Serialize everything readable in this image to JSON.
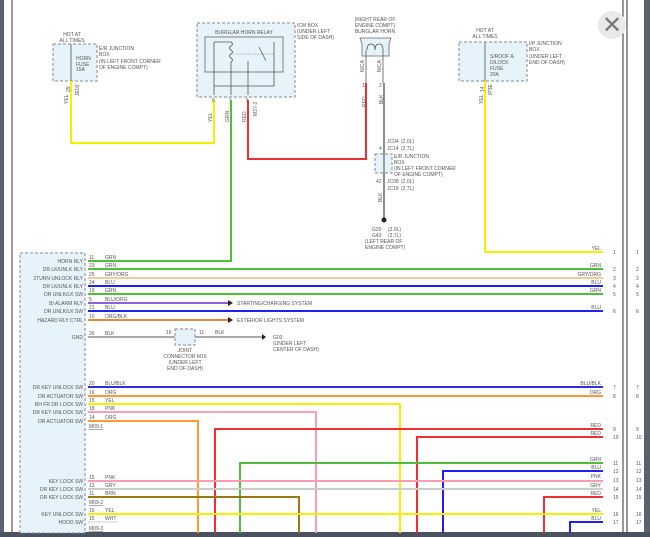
{
  "close_button": {
    "icon": "close-icon",
    "glyph": "✕"
  },
  "horn_fuse": {
    "hot": [
      "HOT AT",
      "ALL TIMES"
    ],
    "fuse": [
      "HORN",
      "FUSE",
      "15A"
    ],
    "location": [
      "E/R JUNCTION",
      "BOX",
      "(IN LEFT FRONT CORNER",
      "OF ENGINE COMPT)"
    ],
    "pin": "29",
    "connector": "JE03",
    "wire": "YEL"
  },
  "icm_box": {
    "title": "BURGLAR HORN RELAY",
    "location": [
      "ICM BOX",
      "(UNDER LEFT",
      "SIDE OF DASH)"
    ],
    "pins": [
      "6",
      "1",
      "5",
      "M37-2"
    ],
    "wires": [
      "YEL",
      "GRN",
      "RED"
    ]
  },
  "horn": {
    "location": [
      "(RIGHT REAR OF",
      "ENGINE COMPT)",
      "BURGLAR HORN"
    ],
    "pins": [
      "1",
      "2"
    ],
    "nca": "N/CA",
    "wires": [
      "RED",
      "BLK"
    ]
  },
  "er_junction": {
    "top": [
      "JC04",
      "(2.0L)",
      "JC14",
      "(2.7L)"
    ],
    "pin_top": "4",
    "location": [
      "E/R JUNCTION",
      "BOX",
      "(IN LEFT FRONT CORNER",
      "OF ENGINE COMPT)"
    ],
    "bottom": [
      "JC08",
      "(2.0L)",
      "JC18",
      "(2.7L)"
    ],
    "pin_bottom": "42",
    "wire": "BLK",
    "ground": [
      "G20",
      "(2.0L)",
      "G43",
      "(2.7L)",
      "(LEFT REAR OF",
      "ENGINE COMPT)"
    ]
  },
  "ip_junction": {
    "hot": [
      "HOT AT",
      "ALL TIMES"
    ],
    "fuse": [
      "S/ROOF &",
      "D/LOCK",
      "FUSE",
      "20A"
    ],
    "location": [
      "I/P JUNCTION",
      "BOX",
      "(UNDER LEFT",
      "END OF DASH)"
    ],
    "pin": "14",
    "connector": "IP3E",
    "wire": "YEL"
  },
  "module_rows": [
    {
      "label": "HORN RLY",
      "pin": "11",
      "wire": "GRN"
    },
    {
      "label": "DR LK/UNLK RLY",
      "pin": "23",
      "wire": "GRN"
    },
    {
      "label": "2TURN UNLOCK RLY",
      "pin": "25",
      "wire": "GRY/ORG"
    },
    {
      "label": "DR LK/UNLK RLY",
      "pin": "24",
      "wire": "BLU"
    },
    {
      "label": "DR UNLK/LK SW",
      "pin": "19",
      "wire": "GRN"
    },
    {
      "label": "B/ ALARM RLY",
      "pin": "5",
      "wire": "BLU/ORG",
      "dest": "STARTING/CHARGING SYSTEM"
    },
    {
      "label": "DR UNLK/LK SW",
      "pin": "21",
      "wire": "BLU"
    },
    {
      "label": "HAZARD RLY CTRL",
      "pin": "10",
      "wire": "ORG/BLK",
      "dest": "EXTERIOR LIGHTS SYSTEM"
    },
    {
      "label": "GND",
      "pin": "26",
      "wire": "BLK"
    },
    {
      "label": "DR KEY UNLOCK SW",
      "pin": "20",
      "wire": "BLU/BLK"
    },
    {
      "label": "DR ACTUATOR SW",
      "pin": "16",
      "wire": "ORG"
    },
    {
      "label": "RH FR DR LOCK SW",
      "pin": "15",
      "wire": "YEL"
    },
    {
      "label": "DR KEY UNLOCK SW",
      "pin": "18",
      "wire": "PNK"
    },
    {
      "label": "DR ACTUATOR SW",
      "pin": "14",
      "wire": "ORG"
    },
    {
      "label": "KEY LOCK SW",
      "pin": "15",
      "wire": "PNK"
    },
    {
      "label": "DR KEY LOCK SW",
      "pin": "13",
      "wire": "GRY"
    },
    {
      "label": "DR KEY LOCK SW",
      "pin": "11",
      "wire": "BRN"
    },
    {
      "label": "KEY UNLOCK SW",
      "pin": "16",
      "wire": "YEL"
    },
    {
      "label": "HOOD SW",
      "pin": "15",
      "wire": "WHT"
    }
  ],
  "connectors": [
    "M09-1",
    "M09-2",
    "M09-3"
  ],
  "joint": {
    "pin_in": "16",
    "pin_out": "11",
    "wire": "BLK",
    "label": [
      "JOINT",
      "CONNECTOR M16",
      "(UNDER LEFT",
      "END OF DASH)"
    ],
    "ground": [
      "G03",
      "(UNDER LEFT",
      "CENTER OF DASH)"
    ]
  },
  "right_rows": [
    {
      "num": "1",
      "wire": "YEL"
    },
    {
      "num": "2",
      "wire": "GRN"
    },
    {
      "num": "3",
      "wire": "GRY/ORG"
    },
    {
      "num": "4",
      "wire": "BLU"
    },
    {
      "num": "5",
      "wire": "GRN"
    },
    {
      "num": "6",
      "wire": "BLU"
    },
    {
      "num": "7",
      "wire": "BLU/BLK"
    },
    {
      "num": "8",
      "wire": "ORG"
    },
    {
      "num": "9",
      "wire": "RED"
    },
    {
      "num": "10",
      "wire": "RED"
    },
    {
      "num": "11",
      "wire": "GRN"
    },
    {
      "num": "12",
      "wire": "BLU"
    },
    {
      "num": "13",
      "wire": "PNK"
    },
    {
      "num": "14",
      "wire": "GRY"
    },
    {
      "num": "15",
      "wire": "RED"
    },
    {
      "num": "16",
      "wire": "YEL"
    },
    {
      "num": "17",
      "wire": "BLU"
    }
  ],
  "colors": {
    "YEL": "#f5f000",
    "GRN": "#4fbf3a",
    "RED": "#f03030",
    "BLU": "#2020f0",
    "GRY/ORG": "#f3c9a0",
    "BLU/ORG": "#9060e0",
    "ORG/BLK": "#e08a40",
    "BLK": "#666666",
    "BLU/BLK": "#3030e0",
    "ORG": "#ff9a30",
    "PNK": "#ff9db0",
    "GRY": "#cccccc",
    "BRN": "#9a7a10",
    "WHT": "#e8e8e8"
  }
}
